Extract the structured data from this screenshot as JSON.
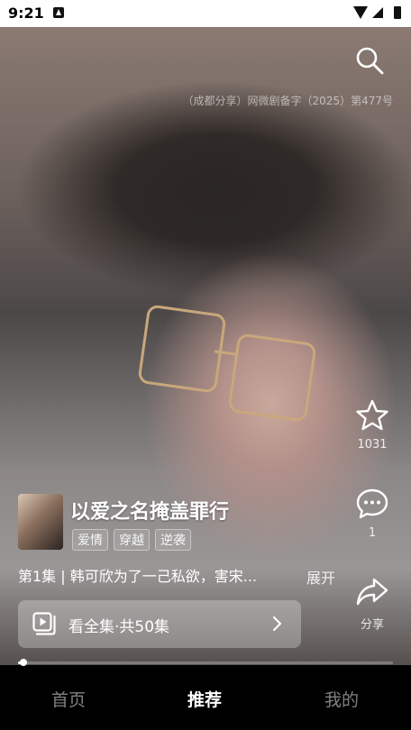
{
  "status_bar": {
    "time": "9:21"
  },
  "top": {
    "search_icon": "search-icon",
    "license": "（成都分享）网微剧备字（2025）第477号"
  },
  "actions": {
    "like": {
      "icon": "star-icon",
      "count": "1031"
    },
    "comment": {
      "icon": "comment-icon",
      "count": "1"
    },
    "share": {
      "icon": "share-icon",
      "label": "分享"
    }
  },
  "drama": {
    "title": "以爱之名掩盖罪行",
    "tags": [
      "爱情",
      "穿越",
      "逆袭"
    ],
    "episode_desc": "第1集 | 韩可欣为了一己私欲，害宋...",
    "expand_label": "展开",
    "watch_all_label": "看全集·共50集"
  },
  "progress": {
    "fraction": 0.01
  },
  "tabs": [
    {
      "label": "首页",
      "active": false
    },
    {
      "label": "推荐",
      "active": true
    },
    {
      "label": "我的",
      "active": false
    }
  ]
}
